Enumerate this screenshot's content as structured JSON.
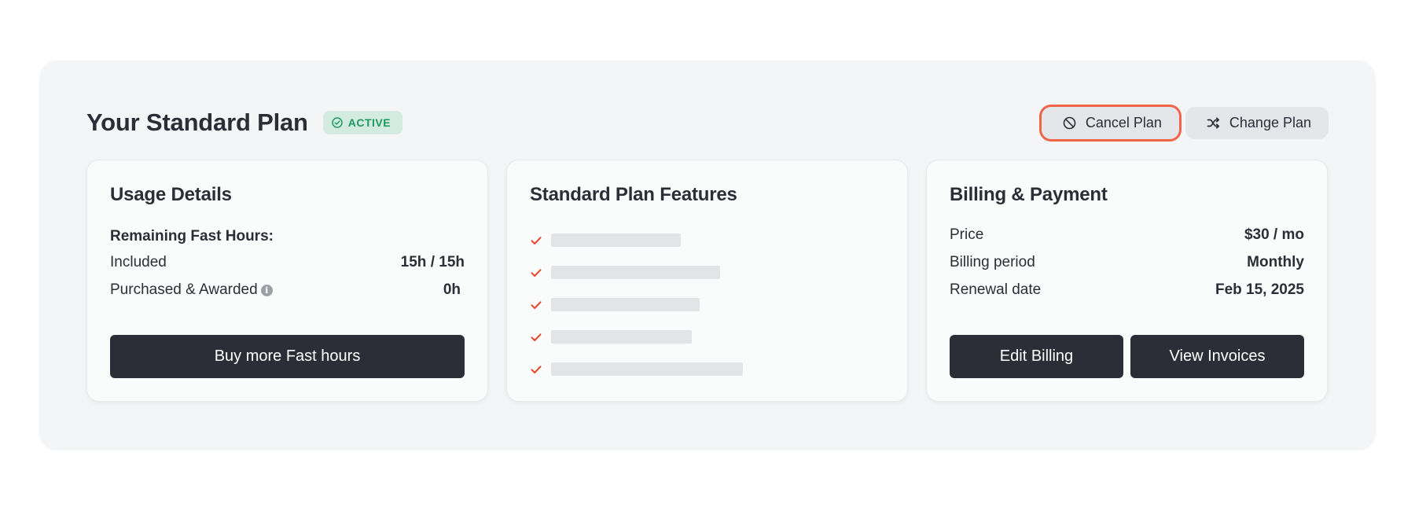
{
  "header": {
    "title": "Your Standard Plan",
    "status_badge": "ACTIVE",
    "cancel_label": "Cancel Plan",
    "change_label": "Change Plan"
  },
  "usage": {
    "title": "Usage Details",
    "subheading": "Remaining Fast Hours:",
    "rows": [
      {
        "label": "Included",
        "value": "15h / 15h"
      },
      {
        "label": "Purchased & Awarded",
        "value": "0h"
      }
    ],
    "button_label": "Buy more Fast hours"
  },
  "features": {
    "title": "Standard Plan Features",
    "items": [
      {
        "icon": "check-icon",
        "content": "redacted"
      },
      {
        "icon": "check-icon",
        "content": "redacted"
      },
      {
        "icon": "check-icon",
        "content": "redacted"
      },
      {
        "icon": "check-icon",
        "content": "redacted"
      },
      {
        "icon": "check-icon",
        "content": "redacted"
      }
    ]
  },
  "billing": {
    "title": "Billing & Payment",
    "rows": [
      {
        "label": "Price",
        "value": "$30 / mo"
      },
      {
        "label": "Billing period",
        "value": "Monthly"
      },
      {
        "label": "Renewal date",
        "value": "Feb 15, 2025"
      }
    ],
    "edit_label": "Edit Billing",
    "invoices_label": "View Invoices"
  },
  "colors": {
    "accent": "#f0644a",
    "active_badge_bg": "#d3ebe0",
    "active_badge_text": "#1f9a5f",
    "dark_button": "#2b2e36"
  }
}
